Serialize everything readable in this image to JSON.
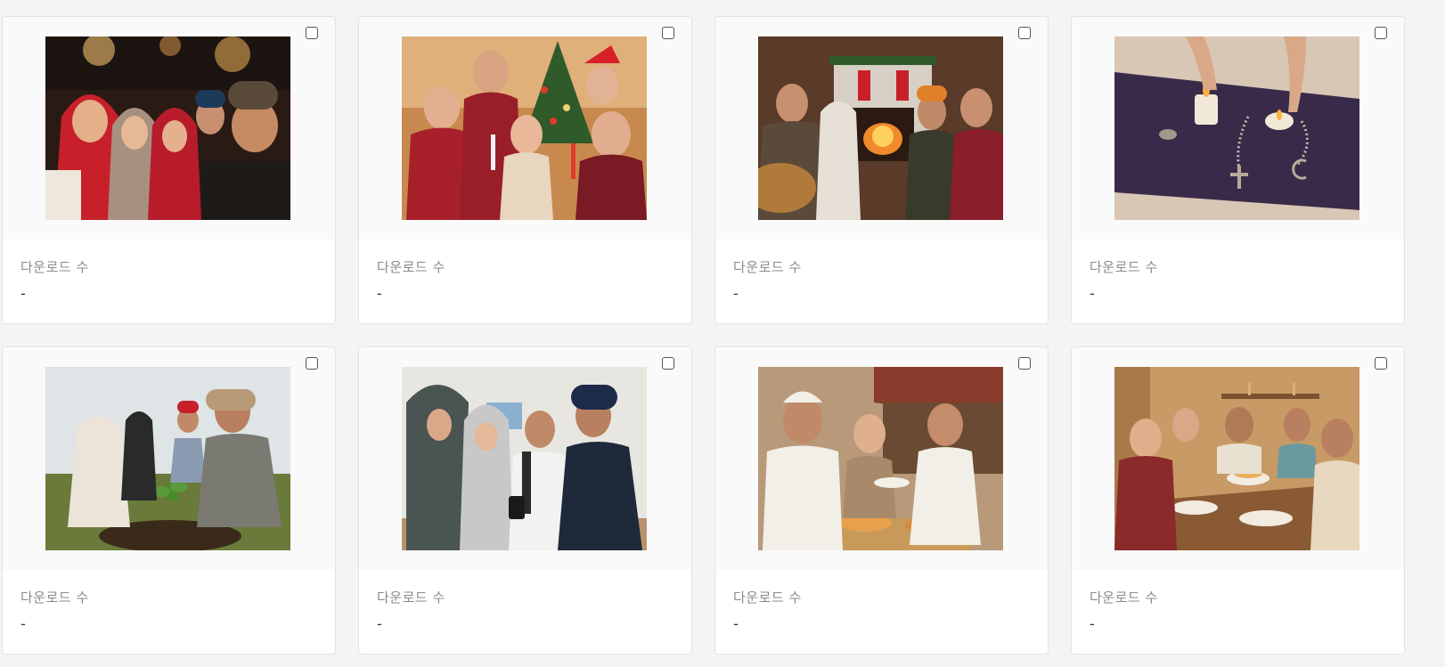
{
  "gallery": {
    "items": [
      {
        "label": "다운로드 수",
        "value": "-",
        "icon": "photo-crowd-street"
      },
      {
        "label": "다운로드 수",
        "value": "-",
        "icon": "photo-children-christmas"
      },
      {
        "label": "다운로드 수",
        "value": "-",
        "icon": "photo-fireplace-music"
      },
      {
        "label": "다운로드 수",
        "value": "-",
        "icon": "photo-candles-prayer"
      },
      {
        "label": "다운로드 수",
        "value": "-",
        "icon": "photo-planting-tree"
      },
      {
        "label": "다운로드 수",
        "value": "-",
        "icon": "photo-group-phone"
      },
      {
        "label": "다운로드 수",
        "value": "-",
        "icon": "photo-street-food"
      },
      {
        "label": "다운로드 수",
        "value": "-",
        "icon": "photo-family-dinner"
      }
    ]
  },
  "colors": {
    "page_bg": "#f4f4f4",
    "card_bg": "#ffffff",
    "thumb_bg": "#fafafa",
    "label": "#8a8a8a",
    "value": "#333333"
  }
}
